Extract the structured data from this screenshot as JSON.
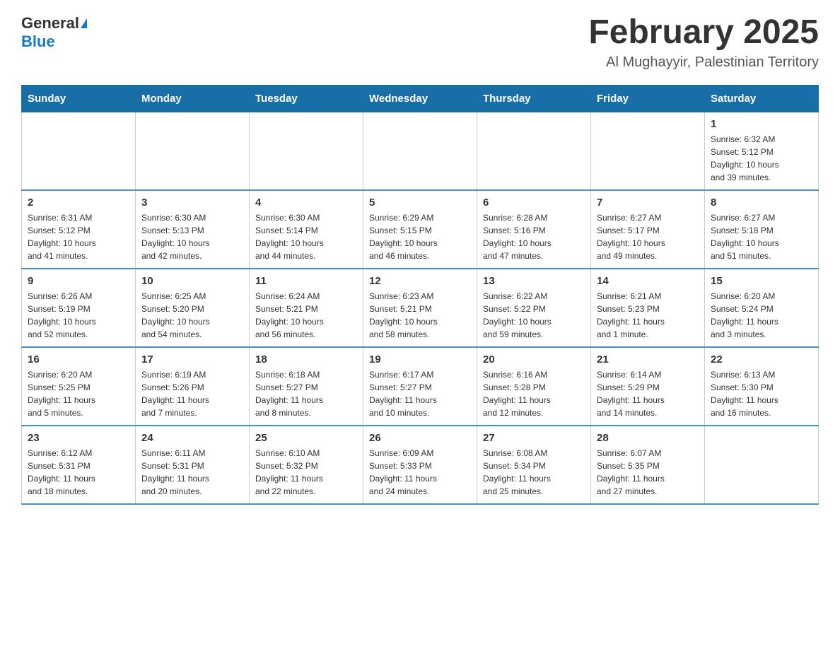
{
  "header": {
    "logo_general": "General",
    "logo_blue": "Blue",
    "title": "February 2025",
    "location": "Al Mughayyir, Palestinian Territory"
  },
  "weekdays": [
    "Sunday",
    "Monday",
    "Tuesday",
    "Wednesday",
    "Thursday",
    "Friday",
    "Saturday"
  ],
  "weeks": [
    [
      {
        "day": "",
        "info": ""
      },
      {
        "day": "",
        "info": ""
      },
      {
        "day": "",
        "info": ""
      },
      {
        "day": "",
        "info": ""
      },
      {
        "day": "",
        "info": ""
      },
      {
        "day": "",
        "info": ""
      },
      {
        "day": "1",
        "info": "Sunrise: 6:32 AM\nSunset: 5:12 PM\nDaylight: 10 hours\nand 39 minutes."
      }
    ],
    [
      {
        "day": "2",
        "info": "Sunrise: 6:31 AM\nSunset: 5:12 PM\nDaylight: 10 hours\nand 41 minutes."
      },
      {
        "day": "3",
        "info": "Sunrise: 6:30 AM\nSunset: 5:13 PM\nDaylight: 10 hours\nand 42 minutes."
      },
      {
        "day": "4",
        "info": "Sunrise: 6:30 AM\nSunset: 5:14 PM\nDaylight: 10 hours\nand 44 minutes."
      },
      {
        "day": "5",
        "info": "Sunrise: 6:29 AM\nSunset: 5:15 PM\nDaylight: 10 hours\nand 46 minutes."
      },
      {
        "day": "6",
        "info": "Sunrise: 6:28 AM\nSunset: 5:16 PM\nDaylight: 10 hours\nand 47 minutes."
      },
      {
        "day": "7",
        "info": "Sunrise: 6:27 AM\nSunset: 5:17 PM\nDaylight: 10 hours\nand 49 minutes."
      },
      {
        "day": "8",
        "info": "Sunrise: 6:27 AM\nSunset: 5:18 PM\nDaylight: 10 hours\nand 51 minutes."
      }
    ],
    [
      {
        "day": "9",
        "info": "Sunrise: 6:26 AM\nSunset: 5:19 PM\nDaylight: 10 hours\nand 52 minutes."
      },
      {
        "day": "10",
        "info": "Sunrise: 6:25 AM\nSunset: 5:20 PM\nDaylight: 10 hours\nand 54 minutes."
      },
      {
        "day": "11",
        "info": "Sunrise: 6:24 AM\nSunset: 5:21 PM\nDaylight: 10 hours\nand 56 minutes."
      },
      {
        "day": "12",
        "info": "Sunrise: 6:23 AM\nSunset: 5:21 PM\nDaylight: 10 hours\nand 58 minutes."
      },
      {
        "day": "13",
        "info": "Sunrise: 6:22 AM\nSunset: 5:22 PM\nDaylight: 10 hours\nand 59 minutes."
      },
      {
        "day": "14",
        "info": "Sunrise: 6:21 AM\nSunset: 5:23 PM\nDaylight: 11 hours\nand 1 minute."
      },
      {
        "day": "15",
        "info": "Sunrise: 6:20 AM\nSunset: 5:24 PM\nDaylight: 11 hours\nand 3 minutes."
      }
    ],
    [
      {
        "day": "16",
        "info": "Sunrise: 6:20 AM\nSunset: 5:25 PM\nDaylight: 11 hours\nand 5 minutes."
      },
      {
        "day": "17",
        "info": "Sunrise: 6:19 AM\nSunset: 5:26 PM\nDaylight: 11 hours\nand 7 minutes."
      },
      {
        "day": "18",
        "info": "Sunrise: 6:18 AM\nSunset: 5:27 PM\nDaylight: 11 hours\nand 8 minutes."
      },
      {
        "day": "19",
        "info": "Sunrise: 6:17 AM\nSunset: 5:27 PM\nDaylight: 11 hours\nand 10 minutes."
      },
      {
        "day": "20",
        "info": "Sunrise: 6:16 AM\nSunset: 5:28 PM\nDaylight: 11 hours\nand 12 minutes."
      },
      {
        "day": "21",
        "info": "Sunrise: 6:14 AM\nSunset: 5:29 PM\nDaylight: 11 hours\nand 14 minutes."
      },
      {
        "day": "22",
        "info": "Sunrise: 6:13 AM\nSunset: 5:30 PM\nDaylight: 11 hours\nand 16 minutes."
      }
    ],
    [
      {
        "day": "23",
        "info": "Sunrise: 6:12 AM\nSunset: 5:31 PM\nDaylight: 11 hours\nand 18 minutes."
      },
      {
        "day": "24",
        "info": "Sunrise: 6:11 AM\nSunset: 5:31 PM\nDaylight: 11 hours\nand 20 minutes."
      },
      {
        "day": "25",
        "info": "Sunrise: 6:10 AM\nSunset: 5:32 PM\nDaylight: 11 hours\nand 22 minutes."
      },
      {
        "day": "26",
        "info": "Sunrise: 6:09 AM\nSunset: 5:33 PM\nDaylight: 11 hours\nand 24 minutes."
      },
      {
        "day": "27",
        "info": "Sunrise: 6:08 AM\nSunset: 5:34 PM\nDaylight: 11 hours\nand 25 minutes."
      },
      {
        "day": "28",
        "info": "Sunrise: 6:07 AM\nSunset: 5:35 PM\nDaylight: 11 hours\nand 27 minutes."
      },
      {
        "day": "",
        "info": ""
      }
    ]
  ]
}
